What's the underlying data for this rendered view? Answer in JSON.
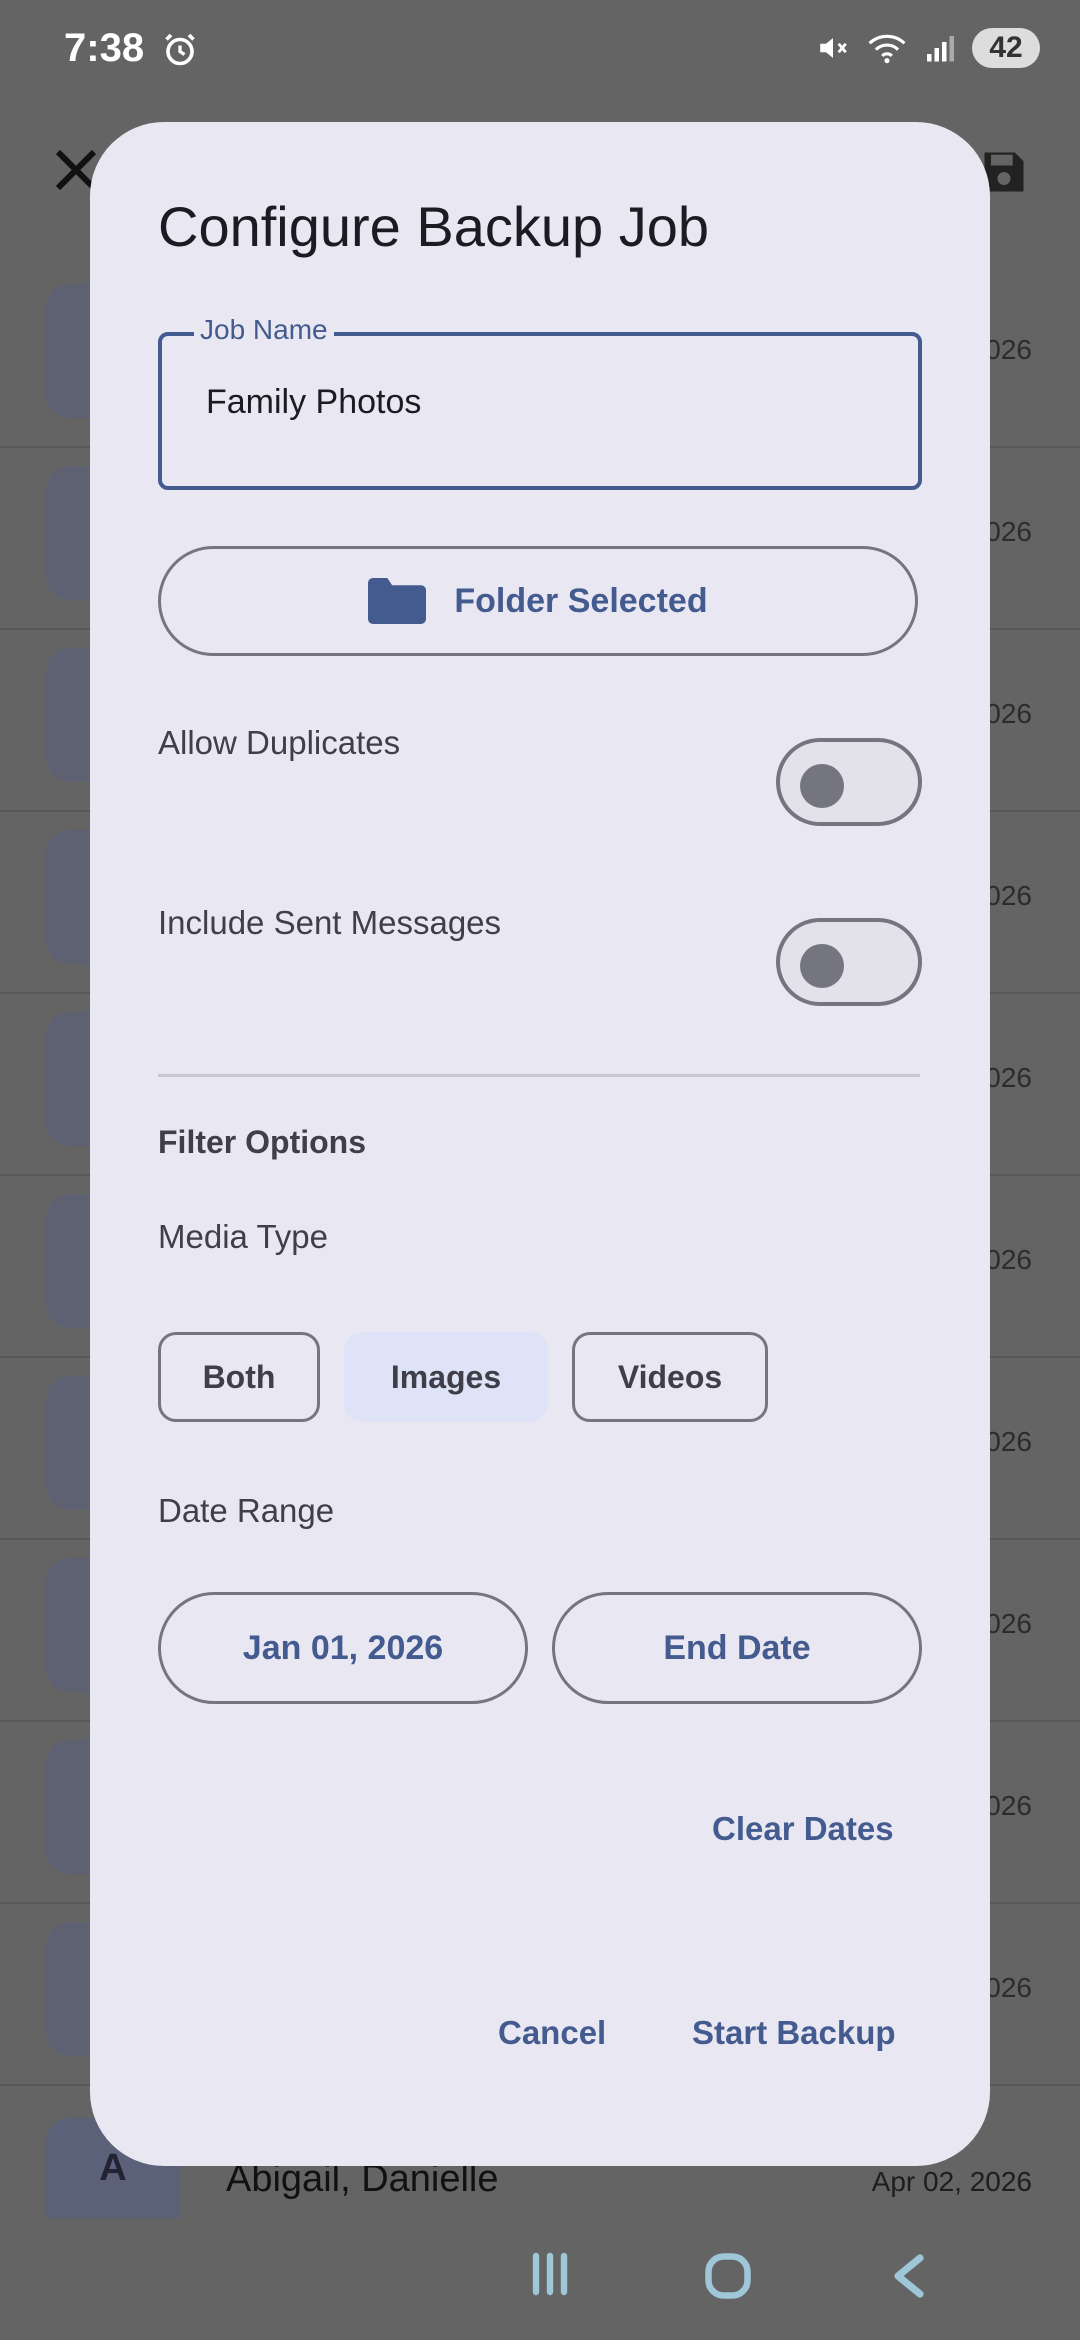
{
  "status_bar": {
    "time": "7:38",
    "battery": "42",
    "icons": [
      "alarm-icon",
      "mute-icon",
      "wifi-icon",
      "signal-icon"
    ]
  },
  "background": {
    "rows": [
      {
        "date_tail": "026"
      },
      {
        "date_tail": "026"
      },
      {
        "date_tail": "026"
      },
      {
        "date_tail": "026"
      },
      {
        "date_tail": "026"
      },
      {
        "date_tail": "026"
      },
      {
        "date_tail": "026"
      },
      {
        "date_tail": "026"
      },
      {
        "date_tail": "026"
      },
      {
        "date_tail": "026"
      }
    ],
    "last_row": {
      "avatar_letter": "A",
      "name": "Abigail, Danielle",
      "date": "Apr 02, 2026"
    }
  },
  "dialog": {
    "title": "Configure Backup Job",
    "job_name": {
      "label": "Job Name",
      "value": "Family Photos"
    },
    "folder_button": "Folder Selected",
    "toggles": [
      {
        "label": "Allow Duplicates",
        "on": false
      },
      {
        "label": "Include Sent Messages",
        "on": false
      }
    ],
    "filter_heading": "Filter Options",
    "media_type_label": "Media Type",
    "media_options": [
      "Both",
      "Images",
      "Videos"
    ],
    "media_selected": "Images",
    "date_range_label": "Date Range",
    "start_date": "Jan 01, 2026",
    "end_date": "End Date",
    "clear_dates": "Clear Dates",
    "cancel": "Cancel",
    "start_backup": "Start Backup"
  },
  "colors": {
    "accent": "#445b8f",
    "dialog_bg": "#e9e7f2",
    "scrim": "#646464"
  }
}
